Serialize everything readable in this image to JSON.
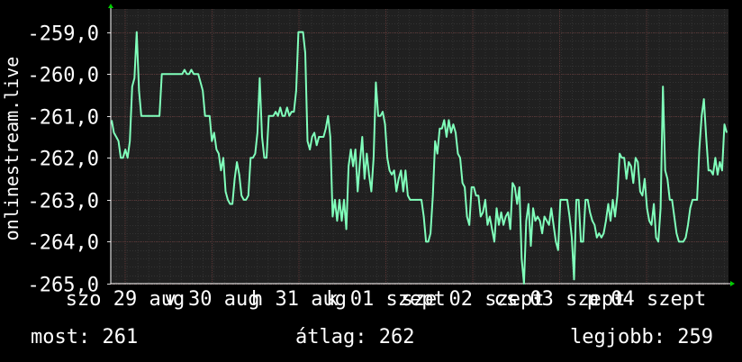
{
  "chart_data": {
    "type": "line",
    "ylabel": "onlinestream.live",
    "ylim": [
      -265.0,
      -258.45
    ],
    "y_ticks": [
      "-259,0",
      "-260,0",
      "-261,0",
      "-262,0",
      "-263,0",
      "-264,0",
      "-265,0"
    ],
    "y_tick_values": [
      -259,
      -260,
      -261,
      -262,
      -263,
      -264,
      -265
    ],
    "x_ticks": [
      "szo 29 aug",
      "v 30 aug",
      "h 31 aug",
      "k 01 szept",
      "sze 02 szept",
      "cs 03 szept",
      "p 04 szept"
    ],
    "grid": true,
    "colors": {
      "background": "#000000",
      "plot_background": "#202020",
      "grid_major": "#5a3636",
      "grid_minor": "#333333",
      "line": "#80ffbb",
      "text": "#ffffff",
      "arrow": "#00cc00"
    },
    "series": [
      {
        "values": [
          -261.1,
          -261.4,
          -261.5,
          -261.6,
          -262.0,
          -262.0,
          -261.8,
          -262.0,
          -261.6,
          -260.3,
          -260.1,
          -259.0,
          -260.4,
          -261.0,
          -261.0,
          -261.0,
          -261.0,
          -261.0,
          -261.0,
          -261.0,
          -261.0,
          -261.0,
          -260.0,
          -260.0,
          -260.0,
          -260.0,
          -260.0,
          -260.0,
          -260.0,
          -260.0,
          -260.0,
          -260.0,
          -259.9,
          -260.0,
          -260.0,
          -259.9,
          -260.0,
          -260.0,
          -260.0,
          -260.2,
          -260.4,
          -261.0,
          -261.0,
          -261.0,
          -261.6,
          -261.4,
          -261.8,
          -261.9,
          -262.3,
          -262.0,
          -262.8,
          -263.0,
          -263.1,
          -263.1,
          -262.5,
          -262.1,
          -262.4,
          -262.9,
          -263.0,
          -263.0,
          -262.9,
          -262.0,
          -262.0,
          -261.9,
          -261.4,
          -260.1,
          -261.5,
          -262.0,
          -262.0,
          -261.0,
          -261.0,
          -261.0,
          -260.9,
          -261.0,
          -260.8,
          -261.0,
          -261.0,
          -260.8,
          -261.0,
          -260.9,
          -260.9,
          -260.4,
          -259.0,
          -259.0,
          -259.0,
          -259.5,
          -261.6,
          -261.8,
          -261.5,
          -261.4,
          -261.7,
          -261.5,
          -261.5,
          -261.5,
          -261.3,
          -261.0,
          -261.5,
          -263.4,
          -263.0,
          -263.5,
          -263.0,
          -263.5,
          -263.0,
          -263.7,
          -262.2,
          -261.8,
          -262.2,
          -261.8,
          -262.8,
          -262.1,
          -261.5,
          -262.5,
          -261.9,
          -262.4,
          -262.8,
          -262.0,
          -260.2,
          -261.0,
          -261.0,
          -260.9,
          -261.2,
          -262.0,
          -262.3,
          -262.4,
          -262.3,
          -262.8,
          -262.5,
          -262.3,
          -262.8,
          -262.3,
          -262.9,
          -263.0,
          -263.0,
          -263.0,
          -263.0,
          -263.0,
          -263.0,
          -263.4,
          -264.0,
          -264.0,
          -263.8,
          -262.9,
          -261.6,
          -261.9,
          -261.3,
          -261.3,
          -261.1,
          -261.5,
          -261.1,
          -261.4,
          -261.2,
          -261.4,
          -261.9,
          -262.0,
          -262.6,
          -262.7,
          -263.4,
          -263.6,
          -262.7,
          -262.7,
          -262.9,
          -262.9,
          -263.4,
          -263.3,
          -263.0,
          -263.6,
          -263.4,
          -263.7,
          -264.0,
          -263.2,
          -263.6,
          -263.3,
          -263.6,
          -263.4,
          -263.3,
          -263.7,
          -262.6,
          -262.7,
          -263.1,
          -262.7,
          -264.4,
          -265.0,
          -263.5,
          -263.1,
          -264.1,
          -263.2,
          -263.5,
          -263.4,
          -263.5,
          -263.8,
          -263.4,
          -263.5,
          -263.6,
          -263.2,
          -263.6,
          -264.0,
          -264.2,
          -263.0,
          -263.0,
          -263.0,
          -263.0,
          -263.4,
          -263.9,
          -264.9,
          -263.0,
          -263.0,
          -264.0,
          -264.0,
          -263.0,
          -263.0,
          -263.3,
          -263.5,
          -263.6,
          -263.9,
          -263.8,
          -263.9,
          -263.8,
          -263.5,
          -263.1,
          -263.5,
          -263.0,
          -263.4,
          -262.9,
          -261.9,
          -262.0,
          -262.0,
          -262.5,
          -262.1,
          -262.2,
          -262.6,
          -262.0,
          -262.1,
          -262.8,
          -262.9,
          -262.5,
          -263.2,
          -263.5,
          -263.6,
          -263.1,
          -263.9,
          -264.0,
          -263.2,
          -260.3,
          -262.3,
          -262.5,
          -263.0,
          -263.0,
          -263.4,
          -263.8,
          -264.0,
          -264.0,
          -264.0,
          -263.9,
          -263.6,
          -263.2,
          -263.0,
          -263.0,
          -263.0,
          -261.8,
          -261.0,
          -260.6,
          -261.5,
          -262.3,
          -262.3,
          -262.4,
          -262.0,
          -262.4,
          -262.1,
          -262.3,
          -261.2,
          -261.4
        ]
      }
    ],
    "legend": {
      "now_label": "most:",
      "now_value": "261",
      "avg_label": "átlag:",
      "avg_value": "262",
      "best_label": "legjobb:",
      "best_value": "259"
    }
  }
}
